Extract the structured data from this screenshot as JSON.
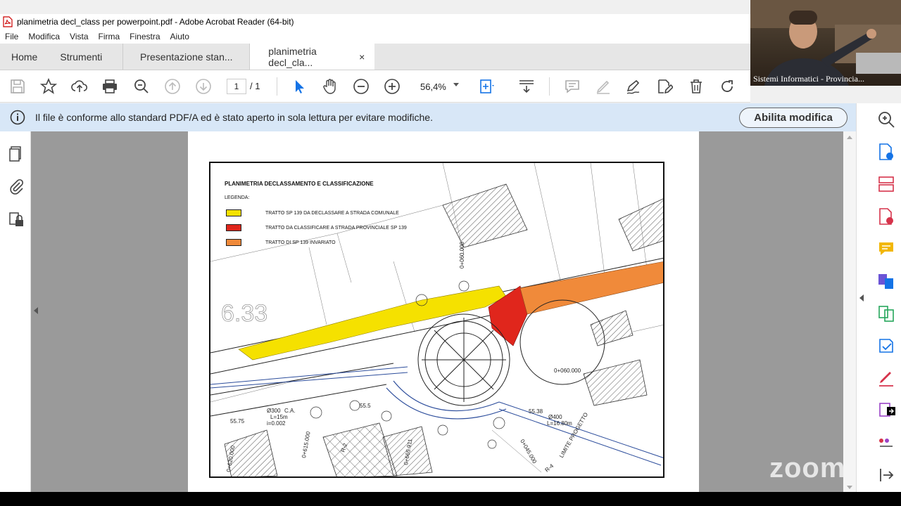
{
  "window": {
    "title": "planimetria decl_class per powerpoint.pdf - Adobe Acrobat Reader (64-bit)"
  },
  "menu": [
    "File",
    "Modifica",
    "Vista",
    "Firma",
    "Finestra",
    "Aiuto"
  ],
  "tabs": {
    "home": "Home",
    "tools": "Strumenti",
    "doc1": "Presentazione stan...",
    "doc2": "planimetria decl_cla...",
    "close": "×"
  },
  "toolbar": {
    "page_current": "1",
    "page_total": "/ 1",
    "zoom": "56,4%"
  },
  "infobar": {
    "message": "Il file è conforme allo standard PDF/A ed è stato aperto in sola lettura per evitare modifiche.",
    "button": "Abilita modifica"
  },
  "map": {
    "title": "PLANIMETRIA DECLASSAMENTO E CLASSIFICAZIONE",
    "legend_label": "LEGENDA:",
    "legend": [
      {
        "label": "TRATTO SP 139 DA DECLASSARE A STRADA COMUNALE",
        "color": "#f5e100"
      },
      {
        "label": "TRATTO DA CLASSIFICARE A STRADA PROVINCIALE SP 139",
        "color": "#e0261c"
      },
      {
        "label": "TRATTO DI SP 139 INVARIATO",
        "color": "#f08a3a"
      }
    ],
    "labels": {
      "big_number": "6.33",
      "lbl_a": "55.75",
      "lbl_b": "55.5",
      "lbl_c": "55.38",
      "lbl_d": "0+060.000",
      "lbl_e": "0+045.000",
      "lbl_f": "0+620.000",
      "lbl_g": "0+665.911",
      "lbl_h": "C.A.",
      "lbl_i": "L=15m",
      "lbl_j": "i=0.002",
      "lbl_k": "Ø300",
      "lbl_l": "0+615.000",
      "lbl_m": "R-2",
      "lbl_n": "R-4",
      "lbl_o": "L=16.80m",
      "lbl_p": "Ø400",
      "lbl_q": "0+060.000",
      "lbl_r": "LIMITE PROGETTO"
    }
  },
  "webcam": {
    "label": "Sistemi Informatici - Provincia..."
  },
  "watermark": "zoom"
}
